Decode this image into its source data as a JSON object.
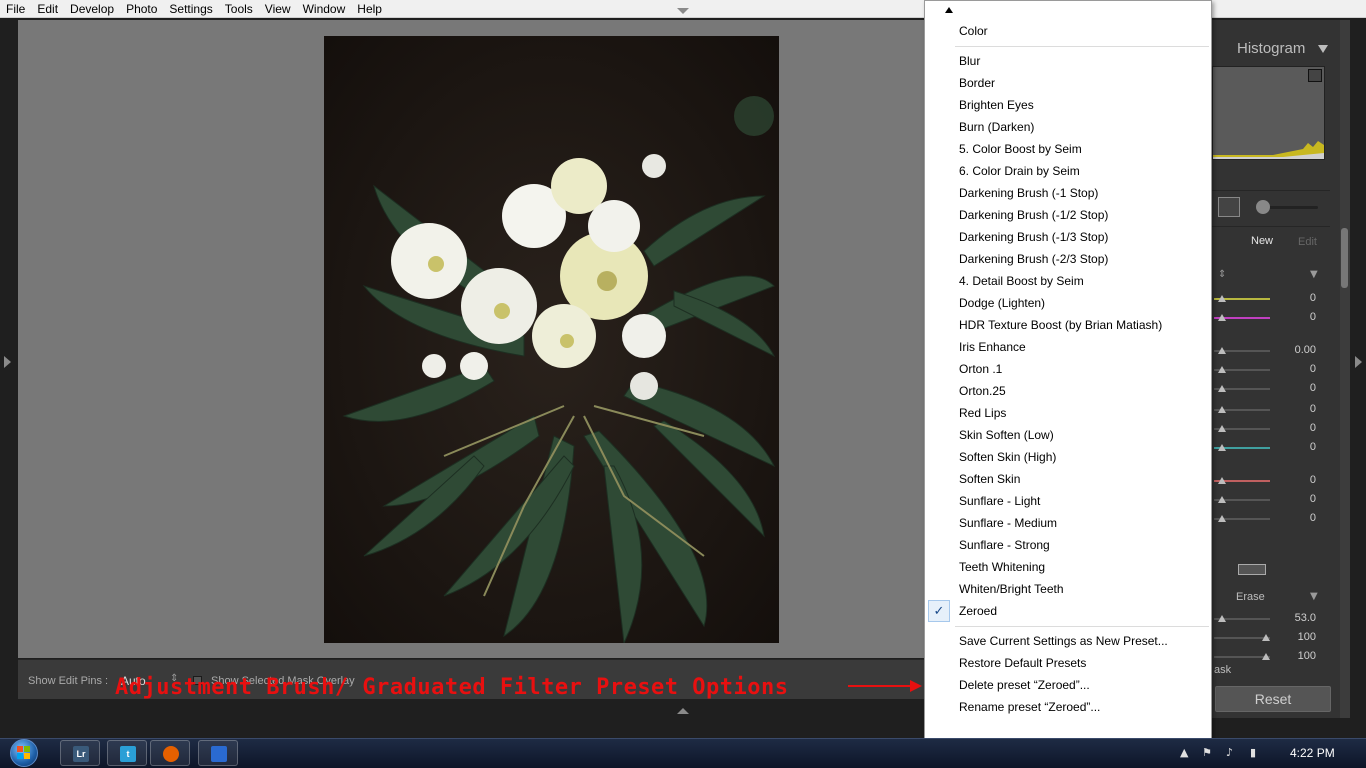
{
  "menubar": {
    "items": [
      "File",
      "Edit",
      "Develop",
      "Photo",
      "Settings",
      "Tools",
      "View",
      "Window",
      "Help"
    ]
  },
  "toolbar": {
    "show_edit_pins_label": "Show Edit Pins :",
    "show_edit_pins_value": "Auto",
    "show_mask_overlay_label": "Show Selected Mask Overlay"
  },
  "annotation": {
    "text": "Adjustment Brush/ Graduated Filter Preset Options"
  },
  "right_panel": {
    "histogram_title": "Histogram",
    "new_label": "New",
    "edit_label": "Edit",
    "erase_label": "Erase",
    "mask_label": "ask",
    "reset_label": "Reset",
    "slider_values": [
      "0",
      "0",
      "0.00",
      "0",
      "0",
      "0",
      "0",
      "0",
      "0",
      "0",
      "0",
      "53.0",
      "100",
      "100"
    ],
    "colors": {
      "panel": "#333333",
      "accent": "#bdbdbd"
    }
  },
  "preset_menu": {
    "top_item": "Color",
    "presets": [
      "Blur",
      "Border",
      "Brighten Eyes",
      "Burn (Darken)",
      "5. Color Boost by Seim",
      "6. Color Drain by Seim",
      "Darkening Brush (-1 Stop)",
      "Darkening Brush (-1/2 Stop)",
      "Darkening Brush (-1/3 Stop)",
      "Darkening Brush (-2/3 Stop)",
      "4. Detail Boost by Seim",
      "Dodge (Lighten)",
      "HDR Texture Boost (by Brian Matiash)",
      "Iris Enhance",
      "Orton .1",
      "Orton.25",
      "Red Lips",
      "Skin Soften (Low)",
      "Soften Skin (High)",
      "Soften Skin",
      "Sunflare - Light",
      "Sunflare - Medium",
      "Sunflare - Strong",
      "Teeth Whitening",
      "Whiten/Bright Teeth",
      "Zeroed"
    ],
    "checked_item": "Zeroed",
    "check_glyph": "✓",
    "actions": [
      "Save Current Settings as New Preset...",
      "Restore Default Presets",
      "Delete preset “Zeroed”...",
      "Rename preset “Zeroed”..."
    ]
  },
  "taskbar": {
    "clock": "4:22 PM",
    "apps": [
      {
        "name": "lightroom-icon",
        "label": "Lr",
        "color": "#3a5a7a"
      },
      {
        "name": "twitter-icon",
        "label": "t",
        "color": "#2a9fd6"
      },
      {
        "name": "firefox-icon",
        "label": "",
        "color": "#e66000"
      },
      {
        "name": "window-app-icon",
        "label": "",
        "color": "#2a6ad0"
      }
    ]
  }
}
